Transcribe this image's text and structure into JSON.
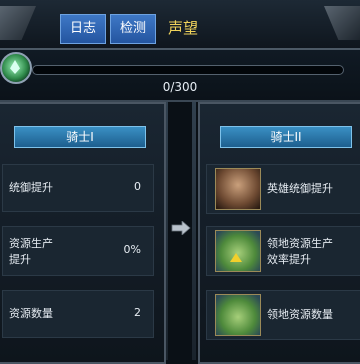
{
  "header": {
    "tab_log": "日志",
    "tab_detect": "检测",
    "title": "声望"
  },
  "progress": {
    "label": "0/300",
    "value": 0,
    "max": 300
  },
  "left_panel": {
    "title": "骑士I",
    "rows": [
      {
        "label_1": "统御提升",
        "label_2": "",
        "value": "0"
      },
      {
        "label_1": "资源生产",
        "label_2": "提升",
        "value": "0%"
      },
      {
        "label_1": "资源数量",
        "label_2": "",
        "value": "2"
      }
    ]
  },
  "right_panel": {
    "title": "骑士II",
    "rows": [
      {
        "icon": "hero-portrait-icon",
        "label_1": "英雄统御提升",
        "label_2": ""
      },
      {
        "icon": "territory-resource-icon",
        "label_1": "领地资源生产",
        "label_2": "效率提升"
      },
      {
        "icon": "territory-land-icon",
        "label_1": "领地资源数量",
        "label_2": ""
      }
    ]
  },
  "colors": {
    "accent_tab": "#2f66b0",
    "title_gold": "#f0d35b",
    "bar_fill": "#3aa4d6"
  }
}
